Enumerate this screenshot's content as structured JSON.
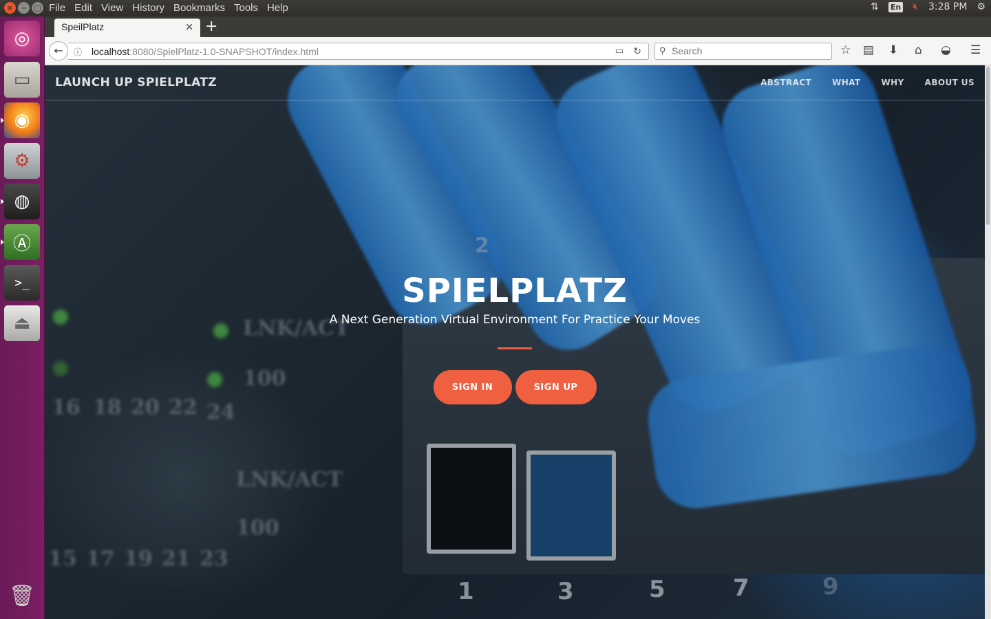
{
  "system": {
    "menus": [
      "File",
      "Edit",
      "View",
      "History",
      "Bookmarks",
      "Tools",
      "Help"
    ],
    "keyboard_lang": "En",
    "clock": "3:28 PM"
  },
  "launcher": {
    "items": [
      "ubuntu-dash",
      "files",
      "firefox",
      "system-settings",
      "disk-utility",
      "software-updater",
      "terminal",
      "usb-creator",
      "trash"
    ]
  },
  "browser": {
    "tab_title": "SpeilPlatz",
    "url_host": "localhost",
    "url_rest": ":8080/SpielPlatz-1.0-SNAPSHOT/index.html",
    "search_placeholder": "Search"
  },
  "site": {
    "brand": "LAUNCH UP SPIELPLATZ",
    "nav": [
      "ABSTRACT",
      "WHAT",
      "WHY",
      "ABOUT US"
    ],
    "hero_title": "SPIELPLATZ",
    "hero_subtitle": "A Next Generation Virtual Environment For Practice Your Moves",
    "sign_in": "SIGN IN",
    "sign_up": "SIGN UP",
    "accent_color": "#f05f40"
  },
  "photo": {
    "port_numbers": [
      "2",
      "1",
      "3",
      "5",
      "7",
      "9"
    ],
    "labels": [
      "LNK/ACT",
      "100",
      "LNK/ACT",
      "100"
    ],
    "small_numbers": [
      "16",
      "18",
      "20",
      "22",
      "24",
      "15",
      "17",
      "19",
      "21",
      "23"
    ]
  }
}
